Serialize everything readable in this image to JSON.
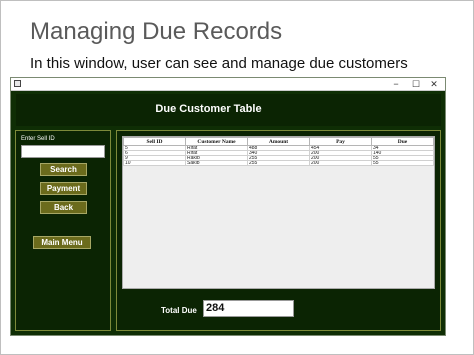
{
  "slide": {
    "title": "Managing Due Records",
    "text": "In this window, user can see and manage due customers"
  },
  "window": {
    "controls": {
      "minimize": "−",
      "maximize": "☐",
      "close": "✕"
    },
    "header_title": "Due Customer Table",
    "sell_id_label": "Enter Sell ID",
    "sell_id_value": "",
    "buttons": {
      "search": "Search",
      "payment": "Payment",
      "back": "Back",
      "main_menu": "Main Menu"
    },
    "table": {
      "columns": [
        "Sell ID",
        "Customer Name",
        "Amount",
        "Pay",
        "Due"
      ],
      "rows": [
        [
          "5",
          "Rifat",
          "488",
          "454",
          "34"
        ],
        [
          "6",
          "Rifat",
          "340",
          "200",
          "140"
        ],
        [
          "9",
          "Rakib",
          "255",
          "200",
          "55"
        ],
        [
          "10",
          "Sakib",
          "255",
          "200",
          "55"
        ]
      ]
    },
    "total_due_label": "Total Due",
    "total_due_value": "284"
  },
  "colors": {
    "window_bg": "#0f2e05",
    "panel_bg": "#0b2403",
    "button_bg": "#6b6b1c",
    "panel_border": "#7d8a3a"
  }
}
